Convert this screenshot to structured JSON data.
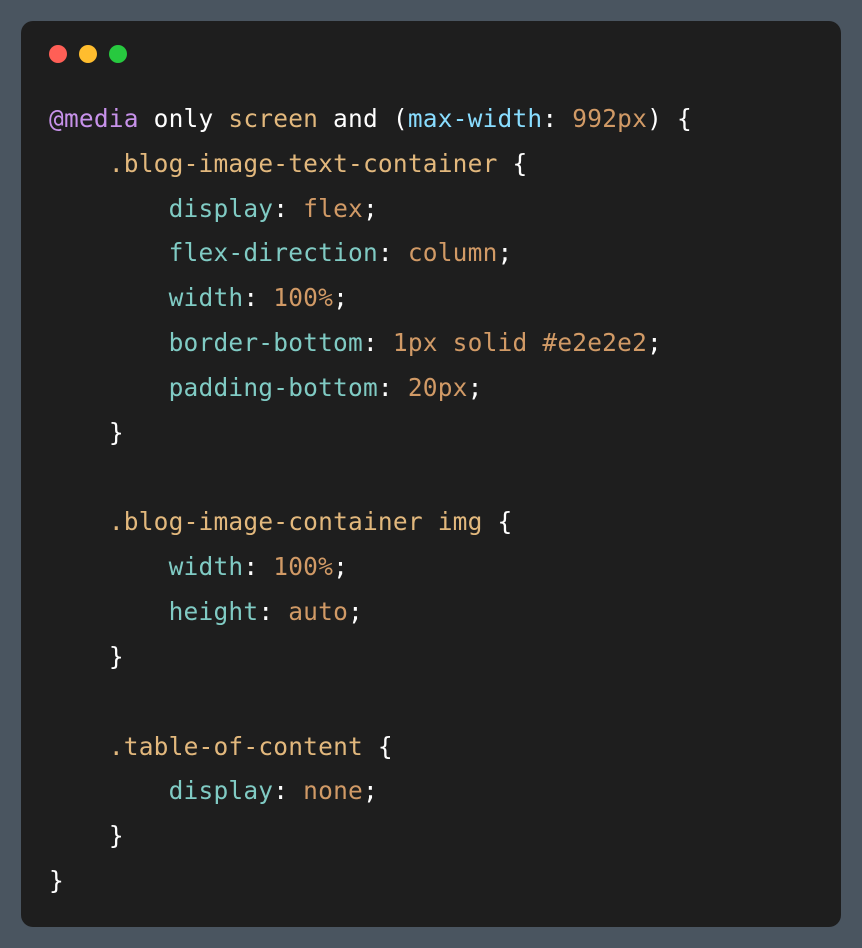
{
  "code": {
    "line1": {
      "atrule": "@media",
      "only": " only ",
      "screen": "screen",
      "and": " and ",
      "lparen": "(",
      "feature": "max-width",
      "colon": ": ",
      "value": "992px",
      "rparen": ")",
      "brace": " {"
    },
    "line2": {
      "indent": "    ",
      "selector": ".blog-image-text-container",
      "brace": " {"
    },
    "line3": {
      "indent": "        ",
      "prop": "display",
      "colon": ": ",
      "value": "flex",
      "semi": ";"
    },
    "line4": {
      "indent": "        ",
      "prop": "flex-direction",
      "colon": ": ",
      "value": "column",
      "semi": ";"
    },
    "line5": {
      "indent": "        ",
      "prop": "width",
      "colon": ": ",
      "value": "100%",
      "semi": ";"
    },
    "line6": {
      "indent": "        ",
      "prop": "border-bottom",
      "colon": ": ",
      "value": "1px solid #e2e2e2",
      "semi": ";"
    },
    "line7": {
      "indent": "        ",
      "prop": "padding-bottom",
      "colon": ": ",
      "value": "20px",
      "semi": ";"
    },
    "line8": {
      "indent": "    ",
      "brace": "}"
    },
    "line9": "",
    "line10": {
      "indent": "    ",
      "selector": ".blog-image-container img",
      "brace": " {"
    },
    "line11": {
      "indent": "        ",
      "prop": "width",
      "colon": ": ",
      "value": "100%",
      "semi": ";"
    },
    "line12": {
      "indent": "        ",
      "prop": "height",
      "colon": ": ",
      "value": "auto",
      "semi": ";"
    },
    "line13": {
      "indent": "    ",
      "brace": "}"
    },
    "line14": "",
    "line15": {
      "indent": "    ",
      "selector": ".table-of-content",
      "brace": " {"
    },
    "line16": {
      "indent": "        ",
      "prop": "display",
      "colon": ": ",
      "value": "none",
      "semi": ";"
    },
    "line17": {
      "indent": "    ",
      "brace": "}"
    },
    "line18": {
      "brace": "}"
    }
  }
}
